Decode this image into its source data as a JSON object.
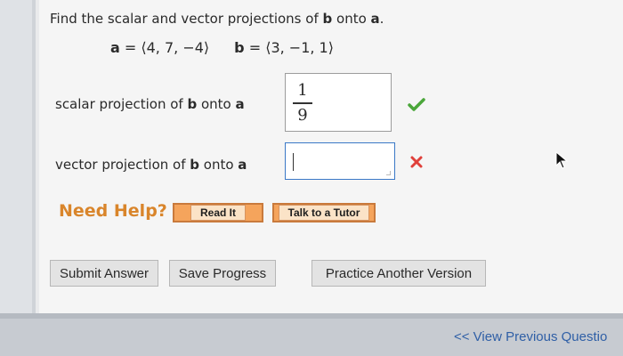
{
  "question": {
    "prefix": "Find the scalar and vector projections of ",
    "b": "b",
    "middle": " onto ",
    "a": "a",
    "suffix": "."
  },
  "vectors": {
    "a_label": "a",
    "a_value": "= ⟨4, 7, −4⟩",
    "b_label": "b",
    "b_value": "= ⟨3, −1, 1⟩"
  },
  "scalar_row": {
    "label_prefix": "scalar projection of ",
    "b": "b",
    "middle": " onto ",
    "a": "a",
    "numerator": "1",
    "denominator": "9",
    "status_icon": "check-icon",
    "status_color": "#4aa63a"
  },
  "vector_row": {
    "label_prefix": "vector projection of ",
    "b": "b",
    "middle": " onto ",
    "a": "a",
    "value": "",
    "status_icon": "cross-icon",
    "status_color": "#e0403a"
  },
  "help": {
    "title": "Need Help?",
    "read_it": "Read It",
    "talk_to_tutor": "Talk to a Tutor"
  },
  "actions": {
    "submit": "Submit Answer",
    "save": "Save Progress",
    "practice": "Practice Another Version"
  },
  "footer": {
    "prev_link": "<< View Previous Questio"
  }
}
